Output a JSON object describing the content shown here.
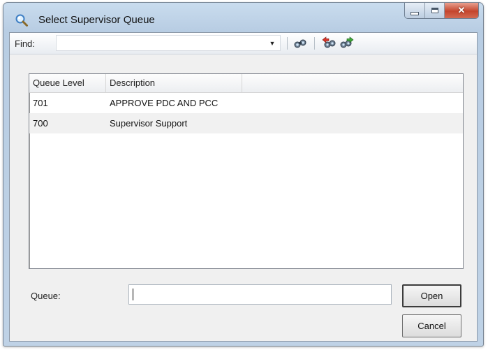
{
  "window": {
    "title": "Select Supervisor Queue",
    "title_icon": "magnifier-icon",
    "controls": {
      "minimize": "minimize-icon",
      "maximize": "maximize-icon",
      "close": "close-icon"
    }
  },
  "toolbar": {
    "find_label": "Find:",
    "find_value": "",
    "find_dropdown_icon": "chevron-down-icon",
    "buttons": [
      "binoculars-icon",
      "find-previous-icon",
      "find-next-icon"
    ]
  },
  "list": {
    "columns": [
      "Queue Level",
      "Description"
    ],
    "rows": [
      {
        "level": "701",
        "description": "APPROVE PDC AND PCC"
      },
      {
        "level": "700",
        "description": "Supervisor Support"
      }
    ]
  },
  "queue": {
    "label": "Queue:",
    "value": ""
  },
  "buttons": {
    "open": "Open",
    "cancel": "Cancel"
  }
}
